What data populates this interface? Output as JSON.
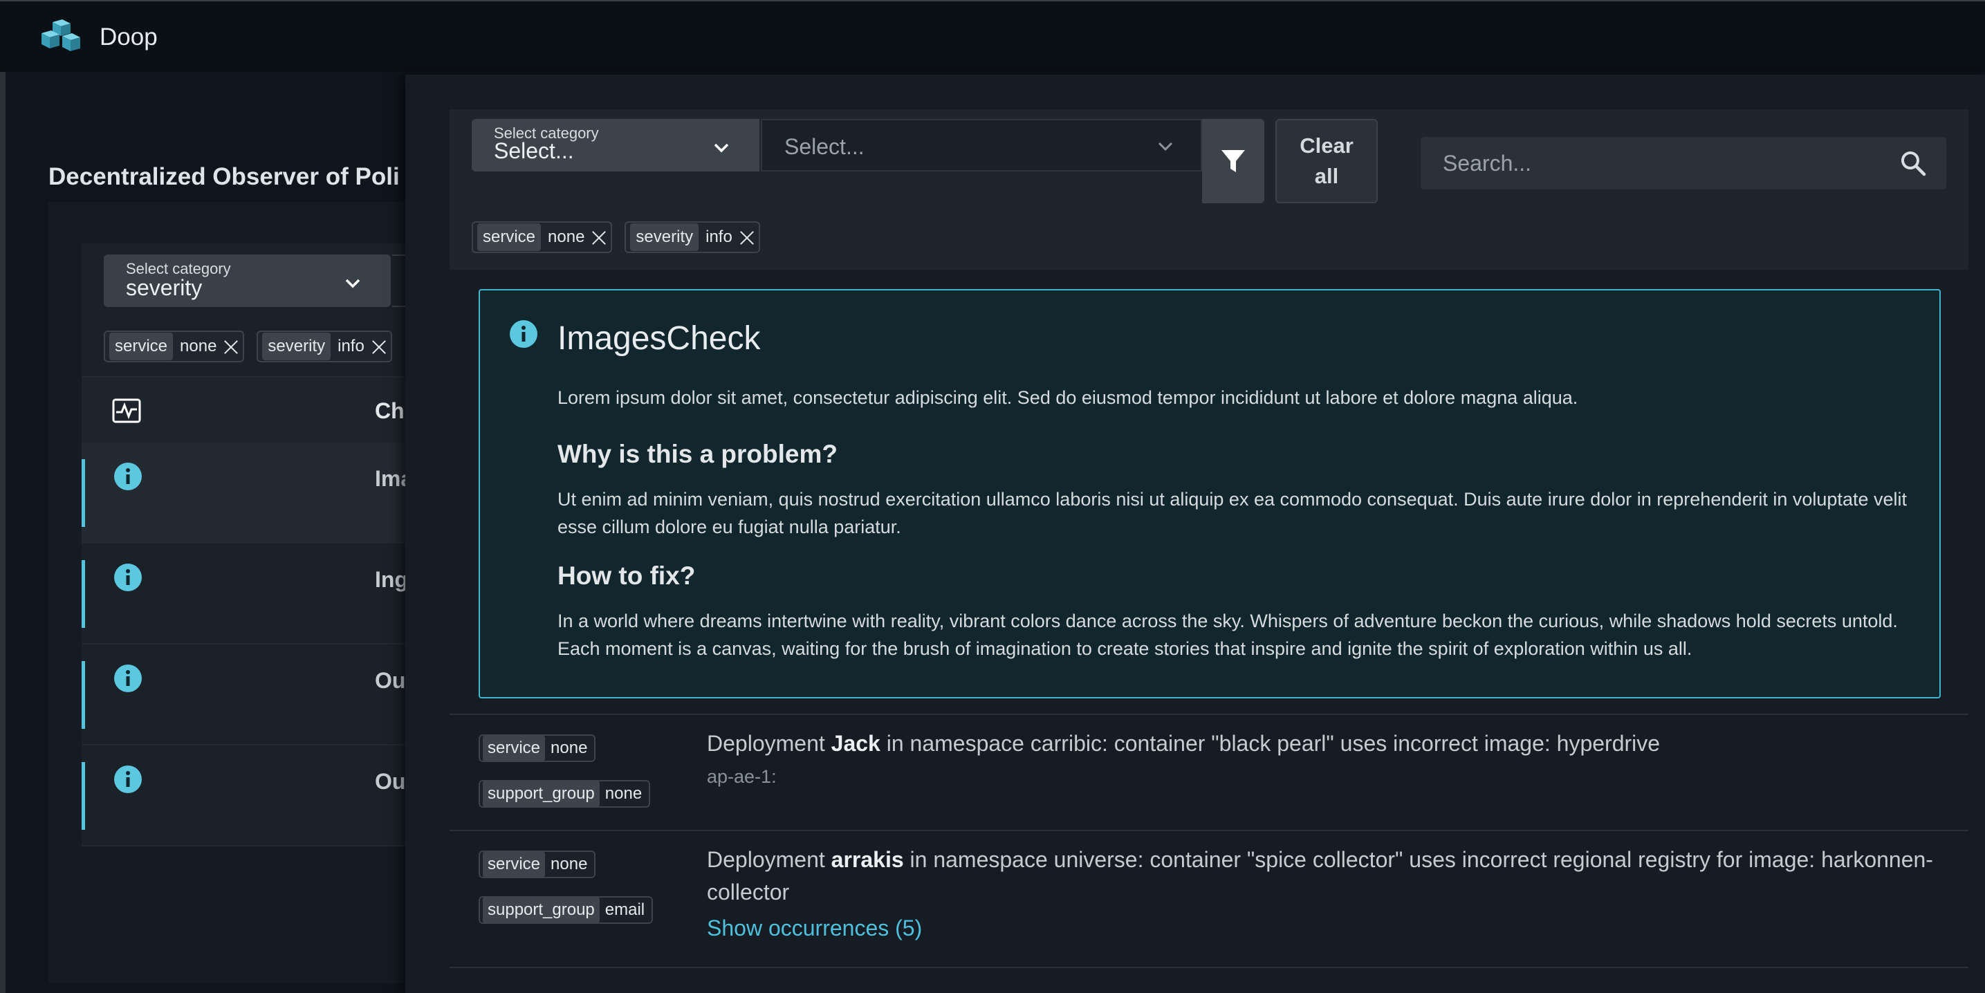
{
  "app": {
    "name": "Doop"
  },
  "background": {
    "page_title": "Decentralized Observer of Poli",
    "select": {
      "small_label": "Select category",
      "value": "severity"
    },
    "pills": [
      {
        "key": "service",
        "value": "none"
      },
      {
        "key": "severity",
        "value": "info"
      }
    ],
    "table_header": "Ch",
    "rows": [
      {
        "label": "Ima"
      },
      {
        "label": "Ing"
      },
      {
        "label": "Ou"
      },
      {
        "label": "Ou"
      }
    ]
  },
  "overlay": {
    "category_select": {
      "small_label": "Select category",
      "value": "Select..."
    },
    "value_select": {
      "placeholder": "Select..."
    },
    "clear_button": "Clear all",
    "search": {
      "placeholder": "Search..."
    },
    "pills": [
      {
        "key": "service",
        "value": "none"
      },
      {
        "key": "severity",
        "value": "info"
      }
    ],
    "detail": {
      "title": "ImagesCheck",
      "description": "Lorem ipsum dolor sit amet, consectetur adipiscing elit. Sed do eiusmod tempor incididunt ut labore et dolore magna aliqua.",
      "why_heading": "Why is this a problem?",
      "why_text": "Ut enim ad minim veniam, quis nostrud exercitation ullamco laboris nisi ut aliquip ex ea commodo consequat. Duis aute irure dolor in reprehenderit in voluptate velit esse cillum dolore eu fugiat nulla pariatur.",
      "fix_heading": "How to fix?",
      "fix_text": "In a world where dreams intertwine with reality, vibrant colors dance across the sky. Whispers of adventure beckon the curious, while shadows hold secrets untold. Each moment is a canvas, waiting for the brush of imagination to create stories that inspire and ignite the spirit of exploration within us all."
    },
    "violations": [
      {
        "tags": [
          {
            "key": "service",
            "value": "none"
          },
          {
            "key": "support_group",
            "value": "none"
          }
        ],
        "msg_prefix": "Deployment ",
        "msg_name": "Jack",
        "msg_suffix": " in namespace carribic: container \"black pearl\" uses incorrect image: hyperdrive",
        "sub": "ap-ae-1:"
      },
      {
        "tags": [
          {
            "key": "service",
            "value": "none"
          },
          {
            "key": "support_group",
            "value": "email"
          }
        ],
        "msg_prefix": "Deployment ",
        "msg_name": "arrakis",
        "msg_suffix": " in namespace universe: container \"spice collector\" uses incorrect regional registry for image: harkonnen-collector",
        "occurrences": "Show occurrences (5)"
      }
    ]
  },
  "colors": {
    "accent": "#4fc0dc",
    "info_icon": "#5cc8e0",
    "panel_bg": "#161c23",
    "detail_border": "#3fb5cf"
  }
}
